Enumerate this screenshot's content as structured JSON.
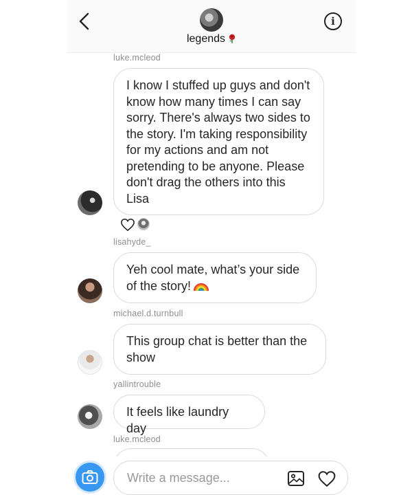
{
  "header": {
    "title": "legends",
    "title_emoji": "rose",
    "back_icon": "chevron-left-icon",
    "info_icon": "info-icon",
    "info_glyph": "i"
  },
  "messages": [
    {
      "username": "luke.mcleod",
      "text": "I know I stuffed up guys and don't know how many times I can say sorry. There's always two sides to the story. I'm taking responsibility for my actions and am not pretending to be anyone. Please don't drag the others into this Lisa",
      "reaction": "heart"
    },
    {
      "username": "lisahyde_",
      "text": "Yeh cool mate, what’s your side of the story!",
      "emoji": "rainbow"
    },
    {
      "username": "michael.d.turnbull",
      "text": "This group chat is better than the show"
    },
    {
      "username": "yallintrouble",
      "text": "It feels like laundry day"
    },
    {
      "username": "luke.mcleod",
      "text": ""
    }
  ],
  "composer": {
    "placeholder": "Write a message...",
    "value": "",
    "camera_icon": "camera-icon",
    "gallery_icon": "gallery-icon",
    "like_icon": "heart-icon"
  },
  "colors": {
    "accent": "#3897f0",
    "bubble_border": "#dbdbdb",
    "username": "#8e8e8e",
    "text": "#262626"
  }
}
